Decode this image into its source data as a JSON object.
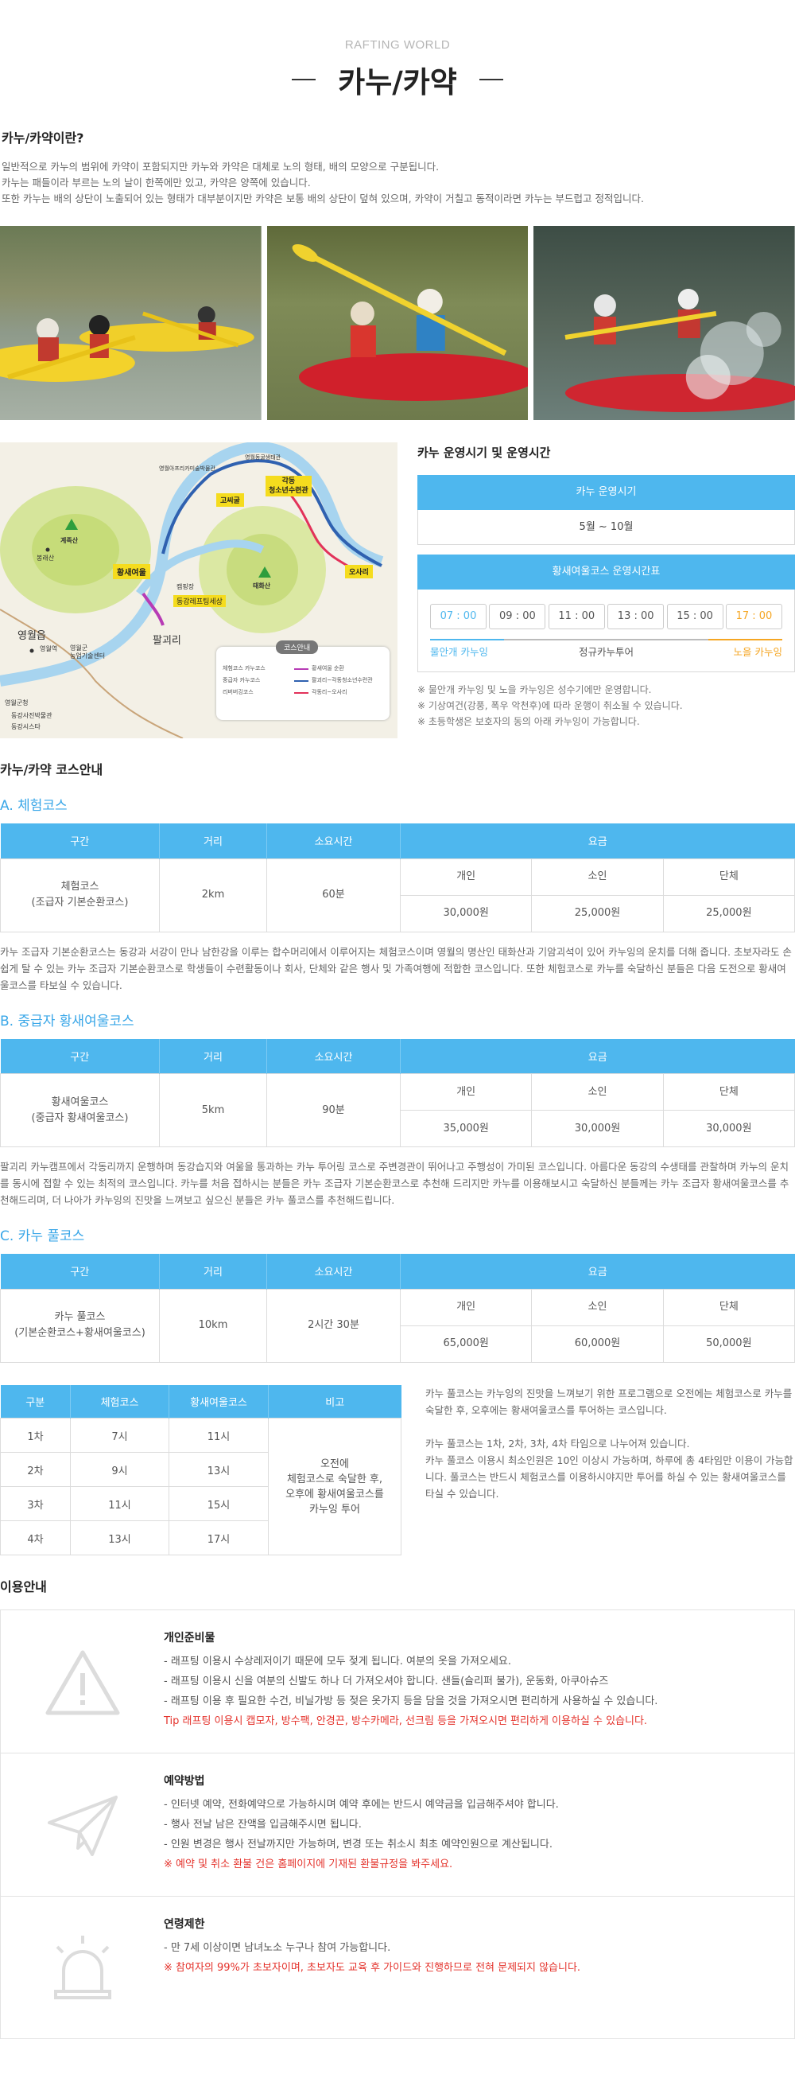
{
  "header": {
    "subtitle": "RAFTING WORLD",
    "title": "카누/카약"
  },
  "intro": {
    "title": "카누/카약이란?",
    "lines": [
      "일반적으로 카누의 범위에 카약이 포함되지만 카누와 카약은 대체로 노의 형태, 배의 모양으로 구분됩니다.",
      "카누는 패들이라 부르는 노의 날이 한쪽에만 있고, 카약은 양쪽에 있습니다.",
      "또한 카누는 배의 상단이 노출되어 있는 형태가 대부분이지만 카약은 보통 배의 상단이 덮혀 있으며, 카약이 거칠고 동적이라면 카누는 부드럽고 정적입니다."
    ]
  },
  "map": {
    "labels": {
      "bongraesan": "봉래산",
      "yeongwol": "영월읍",
      "yeongwol_station": "영월역",
      "nonghyup": "영월군\n농업기술센터",
      "bugi": "영월군청",
      "dongang_tour": "동강사진박물관",
      "dongang_swim": "동강시스타",
      "hwangsae": "황새여울",
      "camp": "캠핑장",
      "camp2": "동강레프팅세상",
      "palgoeri": "팔괴리",
      "gyejoksan": "계족산",
      "taehwasan": "태화산",
      "gakdong": "각동\n청소년수련관",
      "gopigol": "고씨굴",
      "osari": "오사리",
      "top1": "영월동굴생태관",
      "top2": "영월아프리카미술박물관"
    },
    "legend": {
      "title": "코스안내",
      "rows": [
        {
          "left": "체험코스 카누코스",
          "right": "황새여울 순환"
        },
        {
          "left": "중급자 카누코스",
          "right": "팔괴리~각동청소년수련관"
        },
        {
          "left": "리버버깅코스",
          "right": "각동리~오사리"
        }
      ]
    }
  },
  "schedule": {
    "title": "카누 운영시기 및 운영시간",
    "period_head": "카누 운영시기",
    "period_value": "5월 ~ 10월",
    "times_head": "황새여울코스 운영시간표",
    "times": [
      "07 : 00",
      "09 : 00",
      "11 : 00",
      "13 : 00",
      "15 : 00",
      "17 : 00"
    ],
    "left_label": "물안개 카누잉",
    "mid_label": "정규카누투어",
    "right_label": "노을 카누잉",
    "accent_blue": "#4eb7ee",
    "accent_orange": "#f5a623",
    "notes": [
      "※ 물안개 카누잉 및 노을 카누잉은 성수기에만 운영합니다.",
      "※ 기상여건(강풍, 폭우 악천후)에 따라 운행이 취소될 수 있습니다.",
      "※ 초등학생은 보호자의 동의 아래 카누잉이 가능합니다."
    ]
  },
  "courses": {
    "title": "카누/카약 코스안내",
    "head": {
      "section": "구간",
      "distance": "거리",
      "time": "소요시간",
      "fee": "요금"
    },
    "fee_types": [
      "개인",
      "소인",
      "단체"
    ],
    "list": [
      {
        "title": "A. 체험코스",
        "section": "체험코스\n(조급자 기본순환코스)",
        "distance": "2km",
        "time": "60분",
        "fees": [
          "30,000원",
          "25,000원",
          "25,000원"
        ],
        "desc": "카누 조급자 기본순환코스는 동강과 서강이 만나 남한강을 이루는 합수머리에서 이루어지는 체험코스이며 영월의 명산인 태화산과 기암괴석이 있어 카누잉의 운치를 더해 줍니다. 초보자라도 손쉽게 탈 수 있는 카누 조급자 기본순환코스로 학생들이 수련활동이나 회사, 단체와 같은 행사 및 가족여행에 적합한 코스입니다. 또한 체험코스로 카누를 숙달하신 분들은 다음 도전으로 황새여울코스를 타보실 수 있습니다."
      },
      {
        "title": "B. 중급자 황새여울코스",
        "section": "황새여울코스\n(중급자 황새여울코스)",
        "distance": "5km",
        "time": "90분",
        "fees": [
          "35,000원",
          "30,000원",
          "30,000원"
        ],
        "desc": "팔괴리 카누캠프에서 각동리까지 운행하며 동강습지와 여울을 통과하는 카누 투어링 코스로 주변경관이 뛰어나고 주행성이 가미된 코스입니다. 아름다운 동강의 수생태를 관찰하며 카누의 운치를 동시에 접할 수 있는 최적의 코스입니다. 카누를 처음 접하시는 분들은 카누 조급자 기본순환코스로 추천해 드리지만 카누를 이용해보시고 숙달하신 분들께는 카누 조급자 황새여울코스를 추천해드리며, 더 나아가 카누잉의 진맛을 느껴보고 싶으신 분들은 카누 풀코스를 추천해드립니다."
      },
      {
        "title": "C. 카누 풀코스",
        "section": "카누 풀코스\n(기본순환코스+황새여울코스)",
        "distance": "10km",
        "time": "2시간 30분",
        "fees": [
          "65,000원",
          "60,000원",
          "50,000원"
        ],
        "desc": ""
      }
    ]
  },
  "full_schedule": {
    "head": [
      "구분",
      "체험코스",
      "황새여울코스",
      "비고"
    ],
    "rows": [
      [
        "1차",
        "7시",
        "11시"
      ],
      [
        "2차",
        "9시",
        "13시"
      ],
      [
        "3차",
        "11시",
        "15시"
      ],
      [
        "4차",
        "13시",
        "17시"
      ]
    ],
    "remark": "오전에\n체험코스로 숙달한 후,\n오후에 황새여울코스를\n카누잉 투어",
    "text": [
      "카누 풀코스는 카누잉의 진맛을 느껴보기 위한 프로그램으로 오전에는 체험코스로 카누를 숙달한 후, 오후에는 황새여울코스를 투어하는 코스입니다.",
      "",
      "카누 풀코스는 1차, 2차, 3차, 4차 타임으로 나누어져 있습니다.",
      "카누 풀코스 이용시 최소인원은 10인 이상시 가능하며, 하루에 총 4타임만 이용이 가능합니다. 풀코스는 반드시 체험코스를 이용하시야지만 투어를 하실 수 있는 황새여울코스를 타실 수 있습니다."
    ]
  },
  "guide": {
    "title": "이용안내",
    "items": [
      {
        "icon": "warning-icon",
        "title": "개인준비물",
        "lines": [
          "- 래프팅 이용시 수상레저이기 때문에 모두 젖게 됩니다. 여분의 옷을 가져오세요.",
          "- 래프팅 이용시 신을 여분의 신발도 하나 더 가져오셔야 합니다. 샌들(슬리퍼 불가), 운동화, 아쿠아슈즈",
          "- 래프팅 이용 후 필요한 수건, 비닐가방 등 젖은 옷가지 등을 담을 것을 가져오시면 편리하게 사용하실 수 있습니다."
        ],
        "red": "Tip 래프팅 이용시 캡모자, 방수팩, 안경끈, 방수카메라, 선크림 등을 가져오시면 편리하게 이용하실 수 있습니다."
      },
      {
        "icon": "paper-plane-icon",
        "title": "예약방법",
        "lines": [
          "- 인터넷 예약, 전화예약으로 가능하시며 예약 후에는 반드시 예약금을 입금해주셔야 합니다.",
          "- 행사 전날 남은 잔액을 입금해주시면 됩니다.",
          "- 인원 변경은 행사 전날까지만 가능하며, 변경 또는 취소시 최초 예약인원으로 계산됩니다."
        ],
        "red": "※ 예약 및 취소 환불 건은 홈페이지에 기재된 환불규정을 봐주세요."
      },
      {
        "icon": "alarm-light-icon",
        "title": "연령제한",
        "lines": [
          "- 만 7세 이상이면 남녀노소 누구나 참여 가능합니다."
        ],
        "red": "※ 참여자의 99%가 초보자이며, 초보자도 교육 후 가이드와 진행하므로 전혀 문제되지 않습니다."
      }
    ]
  }
}
